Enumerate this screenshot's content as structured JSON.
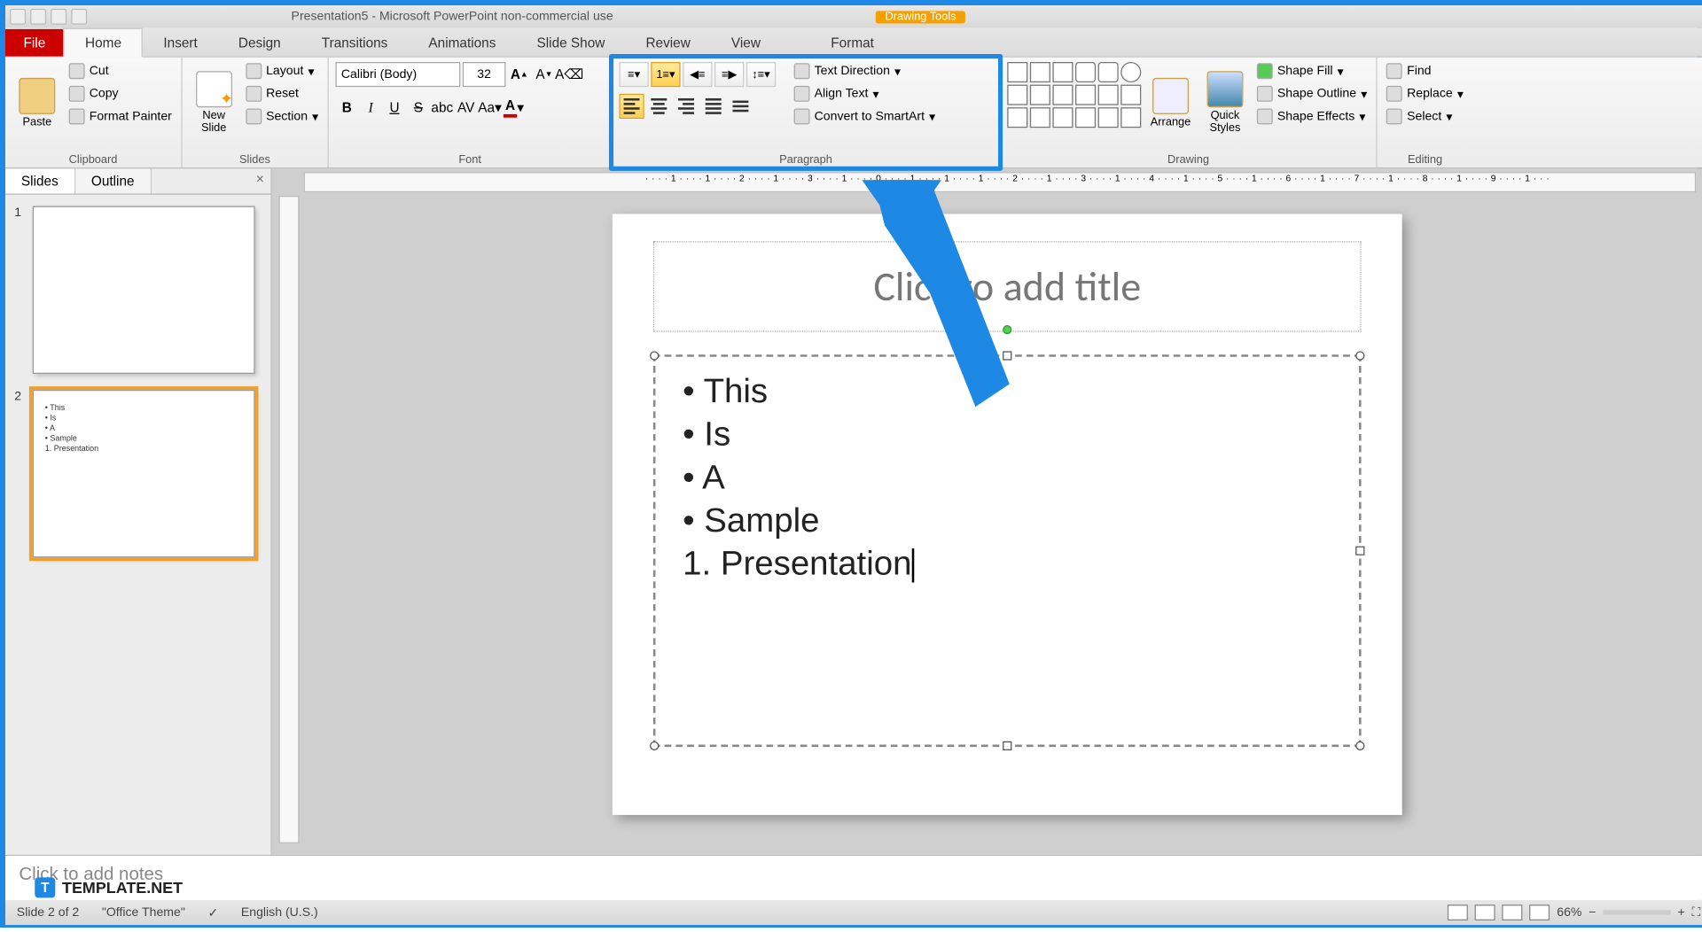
{
  "titlebar": {
    "title": "Presentation5 - Microsoft PowerPoint non-commercial use",
    "drawing_tools": "Drawing Tools"
  },
  "tabs": {
    "file": "File",
    "home": "Home",
    "insert": "Insert",
    "design": "Design",
    "transitions": "Transitions",
    "animations": "Animations",
    "slideshow": "Slide Show",
    "review": "Review",
    "view": "View",
    "format": "Format"
  },
  "ribbon": {
    "clipboard": {
      "label": "Clipboard",
      "paste": "Paste",
      "cut": "Cut",
      "copy": "Copy",
      "format_painter": "Format Painter"
    },
    "slides": {
      "label": "Slides",
      "new_slide": "New\nSlide",
      "layout": "Layout",
      "reset": "Reset",
      "section": "Section"
    },
    "font": {
      "label": "Font",
      "name": "Calibri (Body)",
      "size": "32"
    },
    "paragraph": {
      "label": "Paragraph",
      "text_direction": "Text Direction",
      "align_text": "Align Text",
      "convert_smartart": "Convert to SmartArt"
    },
    "drawing": {
      "label": "Drawing",
      "arrange": "Arrange",
      "quick_styles": "Quick\nStyles",
      "shape_fill": "Shape Fill",
      "shape_outline": "Shape Outline",
      "shape_effects": "Shape Effects"
    },
    "editing": {
      "label": "Editing",
      "find": "Find",
      "replace": "Replace",
      "select": "Select"
    }
  },
  "panel": {
    "slides_tab": "Slides",
    "outline_tab": "Outline",
    "thumbs": [
      {
        "num": "1"
      },
      {
        "num": "2",
        "lines": [
          "This",
          "Is",
          "A",
          "Sample",
          "Presentation"
        ]
      }
    ]
  },
  "slide": {
    "title_placeholder": "Click to add title",
    "content": {
      "b1": "This",
      "b2": "Is",
      "b3": "A",
      "b4": "Sample",
      "n1": "Presentation"
    }
  },
  "notes": {
    "placeholder": "Click to add notes"
  },
  "status": {
    "slide_of": "Slide 2 of 2",
    "theme": "\"Office Theme\"",
    "lang": "English (U.S.)",
    "zoom": "66%"
  },
  "watermark": {
    "text": "TEMPLATE.NET"
  },
  "ruler": {
    "marks": "····1····1····2····1····3····1····0····1····1····1····2····1····3····1····4····1····5····1····6····1····7····1····8····1····9····1···"
  }
}
